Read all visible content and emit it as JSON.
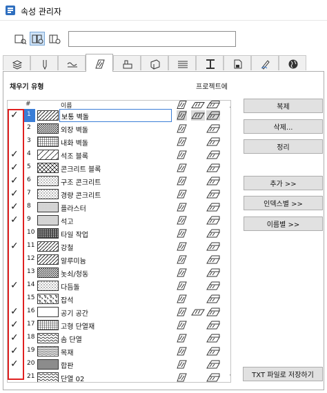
{
  "window": {
    "title": "속성 관리자"
  },
  "search": {
    "value": "",
    "placeholder": ""
  },
  "tabs": [
    {
      "icon": "layers-icon"
    },
    {
      "icon": "pen-icon"
    },
    {
      "icon": "line-type-icon"
    },
    {
      "icon": "fill-icon",
      "active": true
    },
    {
      "icon": "composite-icon"
    },
    {
      "icon": "profile-icon"
    },
    {
      "icon": "surface-icon"
    },
    {
      "icon": "building-material-icon"
    },
    {
      "icon": "zone-category-icon"
    },
    {
      "icon": "markup-icon"
    },
    {
      "icon": "globe-icon"
    }
  ],
  "section": {
    "label": "채우기 유형",
    "project_label": "프로젝트에"
  },
  "columns": {
    "num": "#",
    "name": "이름"
  },
  "rows": [
    {
      "num": "1",
      "name": "보통 벽돌",
      "checked": true,
      "pattern": "diag",
      "selected": true
    },
    {
      "num": "2",
      "name": "외장 벽돌",
      "checked": false,
      "pattern": "diagDense"
    },
    {
      "num": "3",
      "name": "내화 벽돌",
      "checked": false,
      "pattern": "grid"
    },
    {
      "num": "4",
      "name": "석조 블록",
      "checked": true,
      "pattern": "diagWide"
    },
    {
      "num": "5",
      "name": "콘크리트 블록",
      "checked": true,
      "pattern": "cross"
    },
    {
      "num": "6",
      "name": "구조 콘크리트",
      "checked": true,
      "pattern": "dots"
    },
    {
      "num": "7",
      "name": "경량 콘크리트",
      "checked": true,
      "pattern": "dots"
    },
    {
      "num": "8",
      "name": "플라스터",
      "checked": true,
      "pattern": "fineDots"
    },
    {
      "num": "9",
      "name": "석고",
      "checked": true,
      "pattern": "fineDots"
    },
    {
      "num": "10",
      "name": "타일 작업",
      "checked": false,
      "pattern": "tile"
    },
    {
      "num": "11",
      "name": "강철",
      "checked": true,
      "pattern": "diag"
    },
    {
      "num": "12",
      "name": "알루미늄",
      "checked": false,
      "pattern": "diag"
    },
    {
      "num": "13",
      "name": "놋쇠/청동",
      "checked": false,
      "pattern": "diagDense"
    },
    {
      "num": "14",
      "name": "다듬돌",
      "checked": true,
      "pattern": "dots"
    },
    {
      "num": "15",
      "name": "잡석",
      "checked": false,
      "pattern": "rubble"
    },
    {
      "num": "16",
      "name": "공기 공간",
      "checked": true,
      "pattern": "empty"
    },
    {
      "num": "17",
      "name": "고형 단열재",
      "checked": true,
      "pattern": "grid"
    },
    {
      "num": "18",
      "name": "솜 단열",
      "checked": true,
      "pattern": "wave"
    },
    {
      "num": "19",
      "name": "목재",
      "checked": true,
      "pattern": "wood"
    },
    {
      "num": "20",
      "name": "합판",
      "checked": true,
      "pattern": "hlines"
    },
    {
      "num": "21",
      "name": "단열 02",
      "checked": false,
      "pattern": "wave"
    }
  ],
  "buttons": {
    "duplicate": "복제",
    "rename": "삭제...",
    "organize": "정리",
    "add": "추가 >>",
    "by_index": "인덱스별 >>",
    "by_name": "이름별 >>",
    "save_txt": "TXT 파일로 저장하기"
  },
  "colors": {
    "selection": "#3a7dd6",
    "highlight": "#e02020"
  }
}
